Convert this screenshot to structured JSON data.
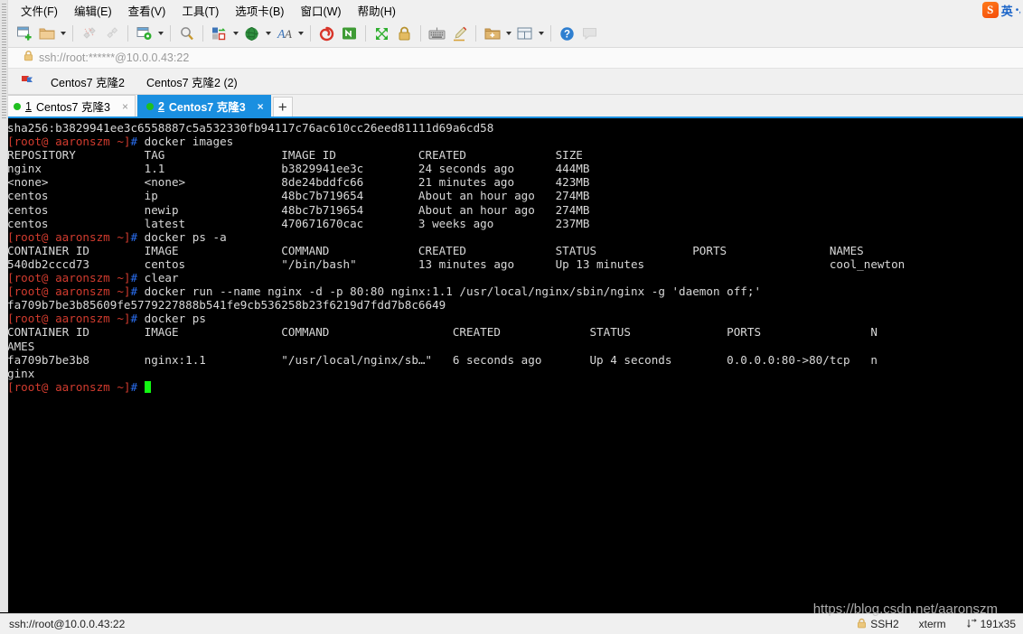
{
  "window": {
    "ime": {
      "logo_char": "S",
      "lang": "英",
      "dots": "•,"
    }
  },
  "menubar": {
    "items": [
      {
        "label": "文件(F)",
        "name": "menu-file"
      },
      {
        "label": "编辑(E)",
        "name": "menu-edit"
      },
      {
        "label": "查看(V)",
        "name": "menu-view"
      },
      {
        "label": "工具(T)",
        "name": "menu-tools"
      },
      {
        "label": "选项卡(B)",
        "name": "menu-tabs"
      },
      {
        "label": "窗口(W)",
        "name": "menu-window"
      },
      {
        "label": "帮助(H)",
        "name": "menu-help"
      }
    ]
  },
  "toolbar": {
    "items": [
      {
        "name": "new-session-icon",
        "icon": "new-session"
      },
      {
        "name": "open-folder-icon",
        "icon": "folder",
        "caret": true
      },
      {
        "sep": true
      },
      {
        "name": "disconnect-icon",
        "icon": "disconnect",
        "disabled": true
      },
      {
        "name": "connect-icon",
        "icon": "chain",
        "disabled": true
      },
      {
        "sep": true
      },
      {
        "name": "session-options-icon",
        "icon": "session-gear",
        "caret": true
      },
      {
        "sep": true
      },
      {
        "name": "find-icon",
        "icon": "magnifier"
      },
      {
        "sep": true
      },
      {
        "name": "transfer-icon",
        "icon": "transfer",
        "caret": true
      },
      {
        "name": "globe-icon",
        "icon": "globe",
        "caret": true
      },
      {
        "name": "font-icon",
        "icon": "font-a",
        "caret": true
      },
      {
        "sep": true
      },
      {
        "name": "spiral-icon",
        "icon": "spiral"
      },
      {
        "name": "sftp-icon",
        "icon": "sftp"
      },
      {
        "sep": true
      },
      {
        "name": "fullscreen-icon",
        "icon": "fullscreen"
      },
      {
        "name": "lock-icon",
        "icon": "lock"
      },
      {
        "sep": true
      },
      {
        "name": "keyboard-icon",
        "icon": "keyboard"
      },
      {
        "name": "highlight-icon",
        "icon": "pen"
      },
      {
        "sep": true
      },
      {
        "name": "add-folder-icon",
        "icon": "add-folder",
        "caret": true
      },
      {
        "name": "layout-icon",
        "icon": "layout",
        "caret": true
      },
      {
        "sep": true
      },
      {
        "name": "help-icon",
        "icon": "help"
      },
      {
        "name": "chat-icon",
        "icon": "chat",
        "disabled": true
      }
    ]
  },
  "urlbar": {
    "lock_icon": "lock-icon",
    "url": "ssh://root:******@10.0.0.43:22"
  },
  "session_row": {
    "flag_icon": "red-flag-icon",
    "sessions": [
      {
        "label": "Centos7 克隆2"
      },
      {
        "label": "Centos7 克隆2 (2)"
      }
    ]
  },
  "tabs": {
    "items": [
      {
        "num": "1",
        "label": "Centos7 克隆3",
        "active": false,
        "close": "×"
      },
      {
        "num": "2",
        "label": "Centos7 克隆3",
        "active": true,
        "close": "×"
      }
    ],
    "new_tab_label": "+"
  },
  "terminal": {
    "prompt": "[root@ aaronszm ~]",
    "hash": "#",
    "lines": [
      {
        "type": "plain",
        "text": "sha256:b3829941ee3c6558887c5a532330fb94117c76ac610cc26eed81111d69a6cd58"
      },
      {
        "type": "cmd",
        "text": " docker images"
      },
      {
        "type": "plain",
        "text": "REPOSITORY          TAG                 IMAGE ID            CREATED             SIZE"
      },
      {
        "type": "plain",
        "text": "nginx               1.1                 b3829941ee3c        24 seconds ago      444MB"
      },
      {
        "type": "plain",
        "text": "<none>              <none>              8de24bddfc66        21 minutes ago      423MB"
      },
      {
        "type": "plain",
        "text": "centos              ip                  48bc7b719654        About an hour ago   274MB"
      },
      {
        "type": "plain",
        "text": "centos              newip               48bc7b719654        About an hour ago   274MB"
      },
      {
        "type": "plain",
        "text": "centos              latest              470671670cac        3 weeks ago         237MB"
      },
      {
        "type": "cmd",
        "text": " docker ps -a"
      },
      {
        "type": "plain",
        "text": "CONTAINER ID        IMAGE               COMMAND             CREATED             STATUS              PORTS               NAMES"
      },
      {
        "type": "plain",
        "text": "540db2cccd73        centos              \"/bin/bash\"         13 minutes ago      Up 13 minutes                           cool_newton"
      },
      {
        "type": "cmd",
        "text": " clear"
      },
      {
        "type": "cmd",
        "text": " docker run --name nginx -d -p 80:80 nginx:1.1 /usr/local/nginx/sbin/nginx -g 'daemon off;'"
      },
      {
        "type": "plain",
        "text": "fa709b7be3b85609fe5779227888b541fe9cb536258b23f6219d7fdd7b8c6649"
      },
      {
        "type": "cmd",
        "text": " docker ps"
      },
      {
        "type": "plain",
        "text": "CONTAINER ID        IMAGE               COMMAND                  CREATED             STATUS              PORTS                N"
      },
      {
        "type": "plain",
        "text": "AMES"
      },
      {
        "type": "plain",
        "text": "fa709b7be3b8        nginx:1.1           \"/usr/local/nginx/sb…\"   6 seconds ago       Up 4 seconds        0.0.0.0:80->80/tcp   n"
      },
      {
        "type": "plain",
        "text": "ginx"
      },
      {
        "type": "prompt-cursor",
        "text": ""
      }
    ]
  },
  "statusbar": {
    "url": "ssh://root@10.0.0.43:22",
    "lock_icon": "lock-icon",
    "protocol": "SSH2",
    "term_type": "xterm",
    "size_icon": "resize-icon",
    "size": "191x35",
    "watermark": "https://blog.csdn.net/aaronszm"
  }
}
